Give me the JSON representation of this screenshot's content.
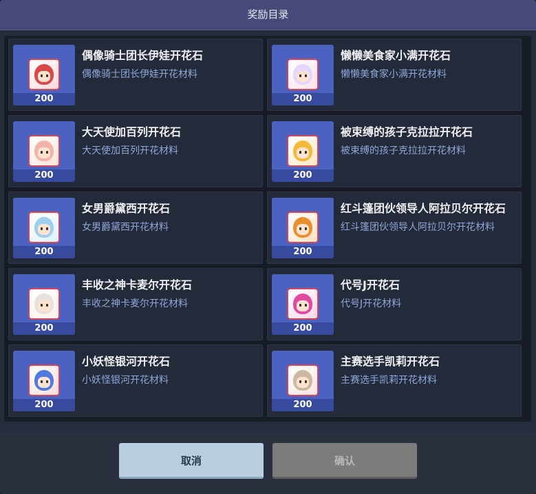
{
  "dialog": {
    "title": "奖励目录"
  },
  "items": [
    {
      "name": "偶像骑士团长伊娃开花石",
      "desc": "偶像骑士团长伊娃开花材料",
      "count": "200",
      "hair": "#d84848",
      "frame": "#ffd9d9"
    },
    {
      "name": "懒懒美食家小满开花石",
      "desc": "懒懒美食家小满开花材料",
      "count": "200",
      "hair": "#e3d7ff",
      "frame": "#ffe0ea"
    },
    {
      "name": "大天使加百列开花石",
      "desc": "大天使加百列开花材料",
      "count": "200",
      "hair": "#f2b4a8",
      "frame": "#ffe4d8"
    },
    {
      "name": "被束缚的孩子克拉拉开花石",
      "desc": "被束缚的孩子克拉拉开花材料",
      "count": "200",
      "hair": "#f2b93a",
      "frame": "#ffe8c0"
    },
    {
      "name": "女男爵黛西开花石",
      "desc": "女男爵黛西开花材料",
      "count": "200",
      "hair": "#9fcff0",
      "frame": "#e0f2ff"
    },
    {
      "name": "红斗篷团伙领导人阿拉贝尔开花石",
      "desc": "红斗篷团伙领导人阿拉贝尔开花材料",
      "count": "200",
      "hair": "#e8902e",
      "frame": "#ffe0c0"
    },
    {
      "name": "丰收之神卡麦尔开花石",
      "desc": "丰收之神卡麦尔开花材料",
      "count": "200",
      "hair": "#e8e2dc",
      "frame": "#fff0ea"
    },
    {
      "name": "代号J开花石",
      "desc": "代号J开花材料",
      "count": "200",
      "hair": "#e04aa0",
      "frame": "#ffd6ea"
    },
    {
      "name": "小妖怪银河开花石",
      "desc": "小妖怪银河开花材料",
      "count": "200",
      "hair": "#4f7be0",
      "frame": "#ffdada"
    },
    {
      "name": "主赛选手凯莉开花石",
      "desc": "主赛选手凯莉开花材料",
      "count": "200",
      "hair": "#cdb8a4",
      "frame": "#ffe4e4"
    }
  ],
  "footer": {
    "cancel_label": "取消",
    "confirm_label": "确认"
  }
}
